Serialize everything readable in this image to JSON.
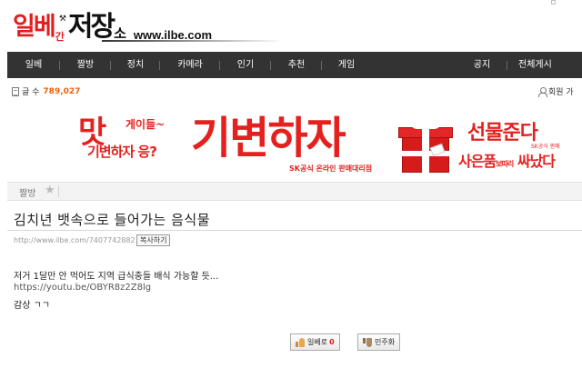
{
  "site": {
    "logo_ilbe": "일베",
    "logo_gan": "간",
    "logo_jeojang": "저장",
    "logo_so": "소",
    "logo_url": "www.ilbe.com"
  },
  "nav": {
    "items": [
      "일베",
      "짤방",
      "정치",
      "카메라",
      "인기",
      "추천",
      "게임"
    ],
    "right_items": [
      "공지",
      "전체게시"
    ]
  },
  "stats": {
    "label": "글 수",
    "count": "789,027",
    "member_link": "회원 가"
  },
  "banner": {
    "mat": "맛",
    "game": "게이들~",
    "question": "기변하자 응?",
    "main": "기변하자",
    "sk_line": "SK공식 온라인 판매대리점",
    "gift": "선물준다",
    "sk_small": "SK공식 판매",
    "bottom_a": "사은품",
    "bottom_small": "보따리",
    "bottom_b": "싸났다"
  },
  "category": {
    "label": "짤방"
  },
  "post": {
    "title": "김치년 뱃속으로 들어가는 음식물",
    "url": "http://www.ilbe.com/7407742882",
    "copy_label": "복사하기",
    "lines": [
      "저거 1달만 안 먹어도 지역 급식충들 배식 가능할 듯...",
      "https://youtu.be/OBYR8z2Z8lg",
      "감상 ㄱㄱ"
    ]
  },
  "votes": {
    "up_label": "일베로",
    "up_count": "0",
    "down_label": "민주화"
  },
  "colors": {
    "brand_red": "#e11d1d",
    "nav_bg": "#333333",
    "count_orange": "#e8630a"
  }
}
